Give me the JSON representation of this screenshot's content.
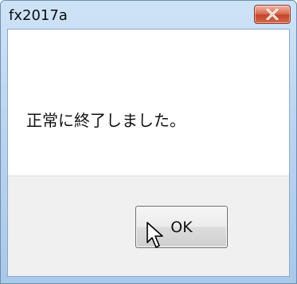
{
  "window": {
    "title": "fx2017a"
  },
  "dialog": {
    "message": "正常に終了しました。",
    "ok_label": "OK"
  },
  "icons": {
    "close": "close-icon",
    "cursor": "mouse-pointer-icon"
  },
  "colors": {
    "title_bar": "#bcd6f1",
    "close_button": "#c2452c",
    "footer": "#f0f0f0"
  }
}
